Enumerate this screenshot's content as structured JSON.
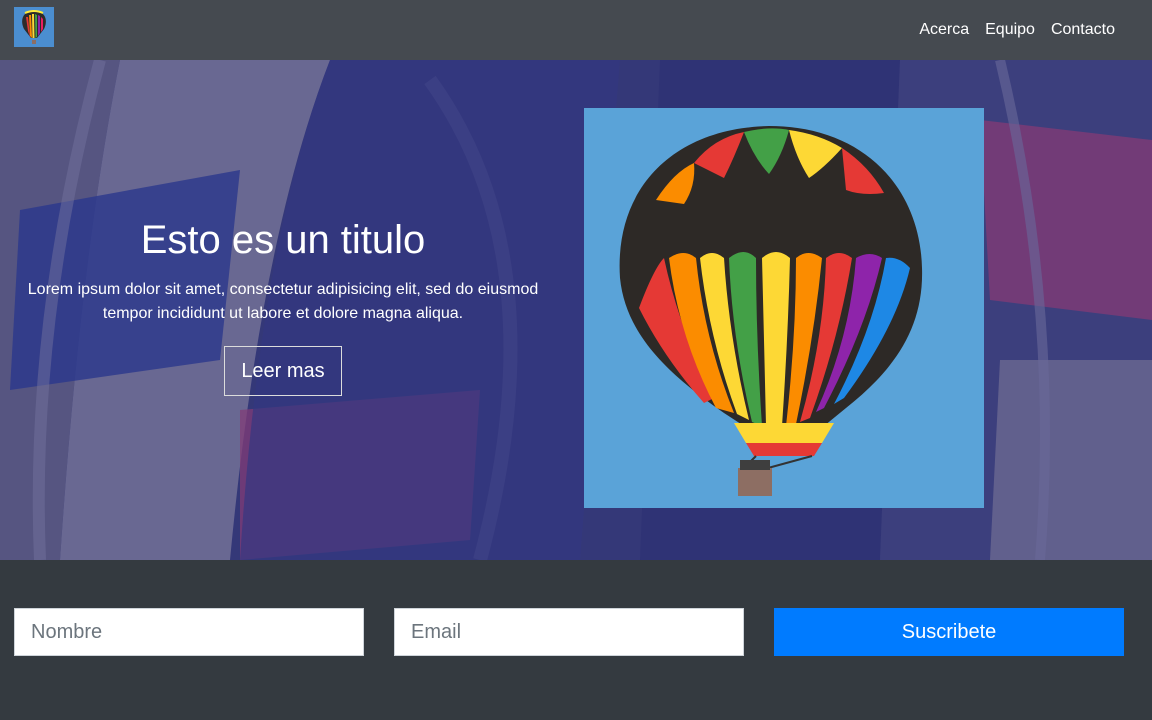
{
  "nav": {
    "logo_icon": "hot-air-balloon-icon",
    "links": [
      "Acerca",
      "Equipo",
      "Contacto"
    ]
  },
  "hero": {
    "title": "Esto es un titulo",
    "text": "Lorem ipsum dolor sit amet, consectetur adipisicing elit, sed do eiusmod tempor incididunt ut labore et dolore magna aliqua.",
    "button_label": "Leer mas",
    "background_icon": "hot-air-balloon-closeup-photo",
    "image_icon": "hot-air-balloon-photo"
  },
  "subscribe": {
    "name_placeholder": "Nombre",
    "email_placeholder": "Email",
    "button_label": "Suscribete"
  },
  "colors": {
    "nav_bg": "#454a50",
    "page_bg": "#343a40",
    "accent": "#007bff",
    "sky": "#5aa3d8"
  }
}
